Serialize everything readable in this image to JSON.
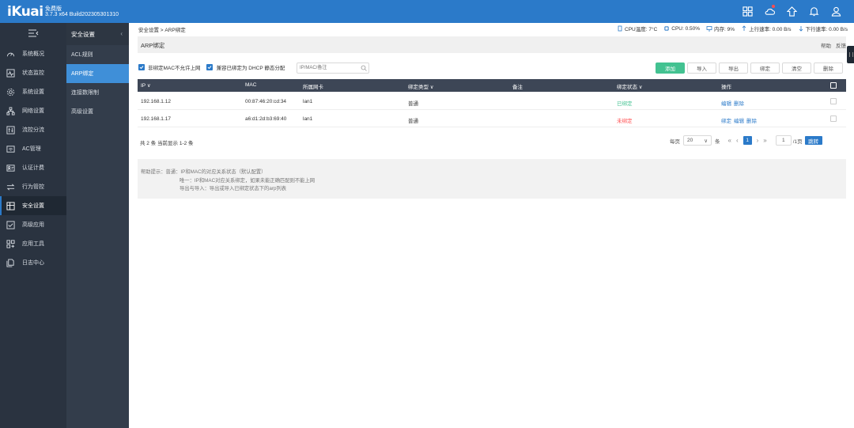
{
  "header": {
    "logo": "iKuai",
    "edition": "免费版",
    "version": "3.7.3 x64 Build202305301310",
    "icons": [
      "apps-icon",
      "cloud-icon",
      "upgrade-icon",
      "bell-icon",
      "user-icon"
    ]
  },
  "sidebar": {
    "items": [
      {
        "label": "系统概况",
        "icon": "dashboard-icon"
      },
      {
        "label": "状态监控",
        "icon": "monitor-icon"
      },
      {
        "label": "系统设置",
        "icon": "gear-icon"
      },
      {
        "label": "网络设置",
        "icon": "network-icon"
      },
      {
        "label": "流控分流",
        "icon": "flow-icon"
      },
      {
        "label": "AC管理",
        "icon": "wifi-icon"
      },
      {
        "label": "认证计费",
        "icon": "auth-icon"
      },
      {
        "label": "行为管控",
        "icon": "behavior-icon"
      },
      {
        "label": "安全设置",
        "icon": "security-icon"
      },
      {
        "label": "高级应用",
        "icon": "advanced-icon"
      },
      {
        "label": "应用工具",
        "icon": "tools-icon"
      },
      {
        "label": "日志中心",
        "icon": "log-icon"
      }
    ]
  },
  "submenu": {
    "title": "安全设置",
    "items": [
      {
        "label": "ACL规则"
      },
      {
        "label": "ARP绑定"
      },
      {
        "label": "连接数限制"
      },
      {
        "label": "高级设置"
      }
    ]
  },
  "breadcrumb": "安全设置 > ARP绑定",
  "status": {
    "cpu_temp": "CPU温度: 7°C",
    "cpu": "CPU: 0.50%",
    "mem": "内存: 9%",
    "up": "上行速率: 0.00 B/s",
    "down": "下行速率: 0.00 B/s"
  },
  "page": {
    "title": "ARP绑定",
    "help": "帮助",
    "feedback": "反馈"
  },
  "filters": {
    "option1": "非绑定MAC不允许上网",
    "option2": "兼容已绑定为 DHCP 静态分配",
    "search_placeholder": "IP/MAC/备注"
  },
  "actions": {
    "add": "添加",
    "import": "导入",
    "export": "导出",
    "bind": "绑定",
    "clear": "清空",
    "delete": "删除"
  },
  "table": {
    "headers": {
      "ip": "IP",
      "mac": "MAC",
      "nic": "所属网卡",
      "type": "绑定类型",
      "note": "备注",
      "state": "绑定状态",
      "op": "操作"
    },
    "rows": [
      {
        "ip": "192.168.1.12",
        "mac": "00:87:46:20:cd:34",
        "nic": "lan1",
        "type": "普通",
        "note": "",
        "state": "已绑定",
        "ops": [
          "编辑",
          "删除"
        ]
      },
      {
        "ip": "192.168.1.17",
        "mac": "a6:d1:2d:b3:69:40",
        "nic": "lan1",
        "type": "普通",
        "note": "",
        "state": "未绑定",
        "ops": [
          "绑定",
          "编辑",
          "删除"
        ]
      }
    ]
  },
  "pagination": {
    "summary": "共 2 条 当前显示 1-2 条",
    "per_page_label": "每页",
    "per_page": "20",
    "unit": "条",
    "current": "1",
    "jump_value": "1",
    "total_pages": "/1页",
    "go": "跳转"
  },
  "help": {
    "line1": "帮助提示：普通：IP和MAC的对应关系状态（默认配置）",
    "line2": "唯一：IP和MAC对应关系绑定，如果未能正确匹配则不能上网",
    "line3": "导出与导入：导出或导入已绑定状态下的arp列表"
  },
  "colors": {
    "header": "#2b7ac9",
    "sidebar": "#2a3340",
    "accent": "#3f8fd8",
    "primary_button": "#43c291",
    "bound": "#43c291",
    "unbound": "#ff4d4f"
  }
}
